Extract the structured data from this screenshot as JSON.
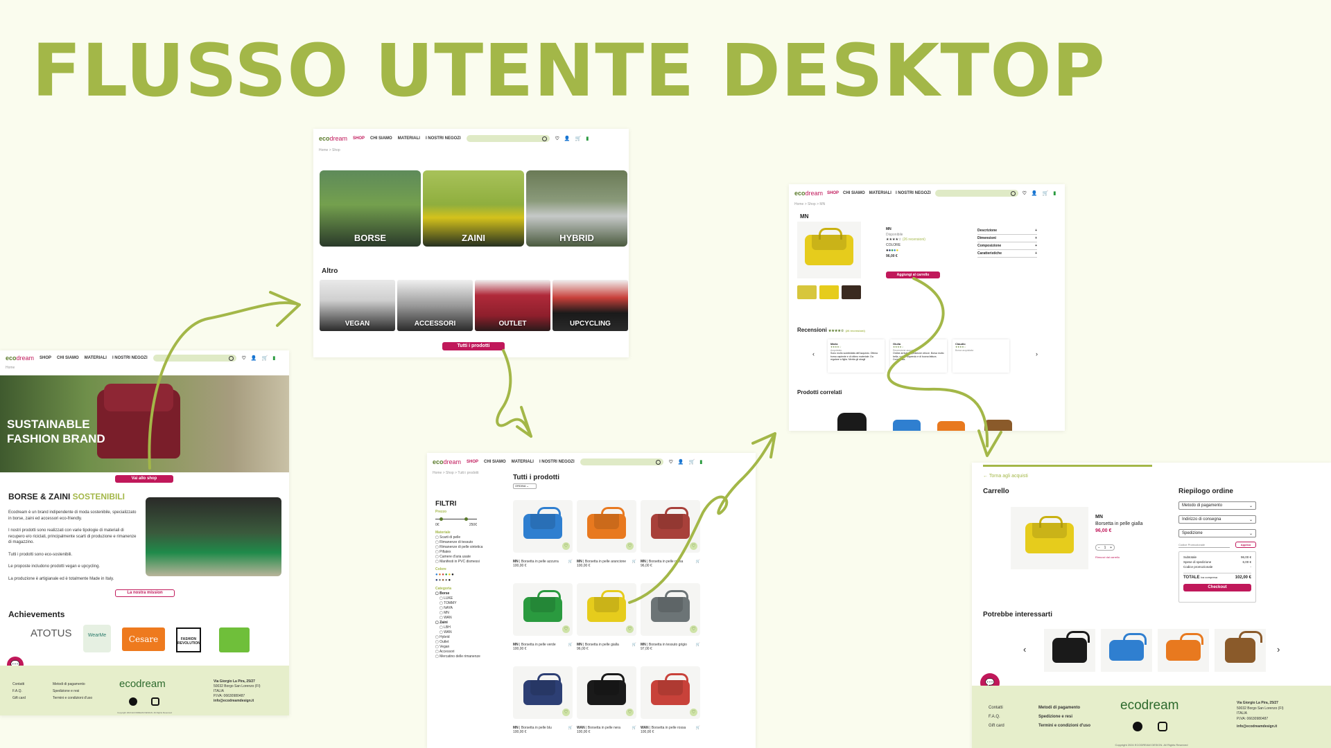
{
  "slide_title": "FLUSSO UTENTE DESKTOP",
  "colors": {
    "accent": "#a3b748",
    "brand": "#c0185a",
    "green": "#5a7a2a",
    "bg": "#fafcee"
  },
  "nav": {
    "logo_main": "eco",
    "logo_accent": "dream",
    "shop": "SHOP",
    "about": "CHI SIAMO",
    "materials": "MATERIALI",
    "stores": "I NOSTRI NEGOZI"
  },
  "home": {
    "crumb": "Home",
    "hero_text": "SUSTAINABLE FASHION BRAND",
    "hero_button": "Vai allo shop",
    "section_title_a": "BORSE & ZAINI ",
    "section_title_b": "SOSTENIBILI",
    "para1": "Ecodream è un brand indipendente di moda sostenibile, specializzato in borse, zaini ed accessori eco-friendly.",
    "para2": "I nostri prodotti sono realizzati con varie tipologie di materiali di recupero e/o riciclati, principalmente scarti di produzione e rimanenze di magazzino.",
    "para3": "Tutti i prodotti sono eco-sostenibili.",
    "para4": "Le proposte includono prodotti vegan e upcycling.",
    "para5": "La produzione è artigianale ed è totalmente Made in Italy.",
    "mission_button": "La nostra mission",
    "achievements_title": "Achievements",
    "badges": [
      "ATOTUS",
      "WearMe",
      "Cesare",
      "FASHION REVOLUTION",
      ""
    ]
  },
  "shop": {
    "crumb": "Home > Shop",
    "tiles": [
      "BORSE",
      "ZAINI",
      "HYBRID"
    ],
    "altro_title": "Altro",
    "altro_tiles": [
      "VEGAN",
      "ACCESSORI",
      "OUTLET",
      "UPCYCLING"
    ],
    "all_button": "Tutti i prodotti"
  },
  "listing": {
    "crumb": "Home > Shop > Tutti i prodotti",
    "filters_title": "FILTRI",
    "title": "Tutti i prodotti",
    "sort": "ORDINA",
    "price_label": "Prezzo",
    "price_min": "0€",
    "price_max": "250€",
    "material_label": "Materiale",
    "materials": [
      "Scarti di pelle",
      "Rimanenze di tessuto",
      "Rimanenze di pelle sintetica",
      "Pifiatex",
      "Camere d'aria usate",
      "Manifesti in PVC dismessi"
    ],
    "color_label": "Colore",
    "category_label": "Categoria",
    "cat_borse": "Borse",
    "borse_sub": [
      "LUKE",
      "TOMMY",
      "NAYA",
      "MN",
      "WAN"
    ],
    "cat_zaini": "Zaini",
    "zaini_sub": [
      "LBH",
      "WAN"
    ],
    "categories_other": [
      "Hybrid",
      "Outlet",
      "Vegan",
      "Accessori",
      "Mercatino delle rimanenze"
    ],
    "products": [
      {
        "name": "MN",
        "desc": "Borsetta in pelle azzurra",
        "price": "100,00 €",
        "color": "#2f7fd0"
      },
      {
        "name": "MN",
        "desc": "Borsetta in pelle arancione",
        "price": "100,00 €",
        "color": "#e8791f"
      },
      {
        "name": "MN",
        "desc": "Borsetta in pelle rossa",
        "price": "96,00 €",
        "color": "#a8403a"
      },
      {
        "name": "MN",
        "desc": "Borsetta in pelle verde",
        "price": "100,00 €",
        "color": "#2a9a3f"
      },
      {
        "name": "MN",
        "desc": "Borsetta in pelle gialla",
        "price": "96,00 €",
        "color": "#e6cc1c"
      },
      {
        "name": "MN",
        "desc": "Borsetta in tessuto grigio",
        "price": "97,00 €",
        "color": "#6c7476"
      },
      {
        "name": "MN",
        "desc": "Borsetta in pelle blu",
        "price": "100,00 €",
        "color": "#2d3f74"
      },
      {
        "name": "WAN",
        "desc": "Borsetta in pelle nera",
        "price": "100,00 €",
        "color": "#1a1a1a"
      },
      {
        "name": "WAN",
        "desc": "Borsetta in pelle rossa",
        "price": "100,00 €",
        "color": "#c8423a"
      }
    ]
  },
  "product": {
    "crumb": "Home > Shop > MN",
    "name": "MN",
    "availability": "Disponibile",
    "reviews_link": "(26 recensioni)",
    "colors_label": "COLORE",
    "price": "96,00 €",
    "add_button": "Aggiungi al carrello",
    "accordion": [
      "Descrizione",
      "Dimensioni",
      "Composizione",
      "Caratteristiche"
    ],
    "reviews_title": "Recensioni",
    "reviews": [
      {
        "author": "Maria",
        "sub": "Acquistato",
        "text": "Sono molto soddisfatta dell'acquisto. Ottima borsa capiente e di ottimo materiale. Da regalare a figlia. Merita gli sbagli"
      },
      {
        "author": "Giulia",
        "sub": "Recensione acquisto",
        "text": "Ordine arrivato, spedizione veloce. Borsa molto bella, colore stupendo e di buona fattura. Consigliata."
      },
      {
        "author": "Claudio",
        "sub": "Borsa acquistata",
        "text": ""
      }
    ],
    "related_title": "Prodotti correlati"
  },
  "cart": {
    "back": "← Torna agli acquisti",
    "title": "Carrello",
    "item_name": "MN",
    "item_desc": "Borsetta in pelle gialla",
    "item_price": "96,00 €",
    "qty": "1",
    "remove": "Rimuovi dal carrello",
    "summary_title": "Riepilogo ordine",
    "selects": [
      "Metodo di pagamento",
      "Indirizzo di consegna",
      "Spedizione"
    ],
    "promo_placeholder": "Codice Promozionale",
    "apply": "Applica",
    "lines": [
      {
        "label": "Subtotale",
        "value": "96,00 €"
      },
      {
        "label": "Spese di spedizione",
        "value": "6,00 €"
      },
      {
        "label": "Codice promozionale",
        "value": "-"
      }
    ],
    "total_label": "TOTALE",
    "total_note": "iva compresa",
    "total_value": "102,00 €",
    "checkout": "Checkout",
    "suggest_title": "Potrebbe interessarti"
  },
  "footer": {
    "col1": [
      "Contatti",
      "F.A.Q.",
      "Gift card"
    ],
    "col2": [
      "Metodi di pagamento",
      "Spedizione e resi",
      "Termini e condizioni d'uso"
    ],
    "brand": "ecodream",
    "addr1": "Via Giorgio La Pira, 25/27",
    "addr2": "50032 Borgo San Lorenzo (FI)",
    "addr3": "ITALIA",
    "vat": "P.IVA: 06630980487",
    "email": "info@ecodreamdesign.it",
    "copyright": "Copyright 2024 ECODREAM DESIGN. All Rights Reserved"
  }
}
